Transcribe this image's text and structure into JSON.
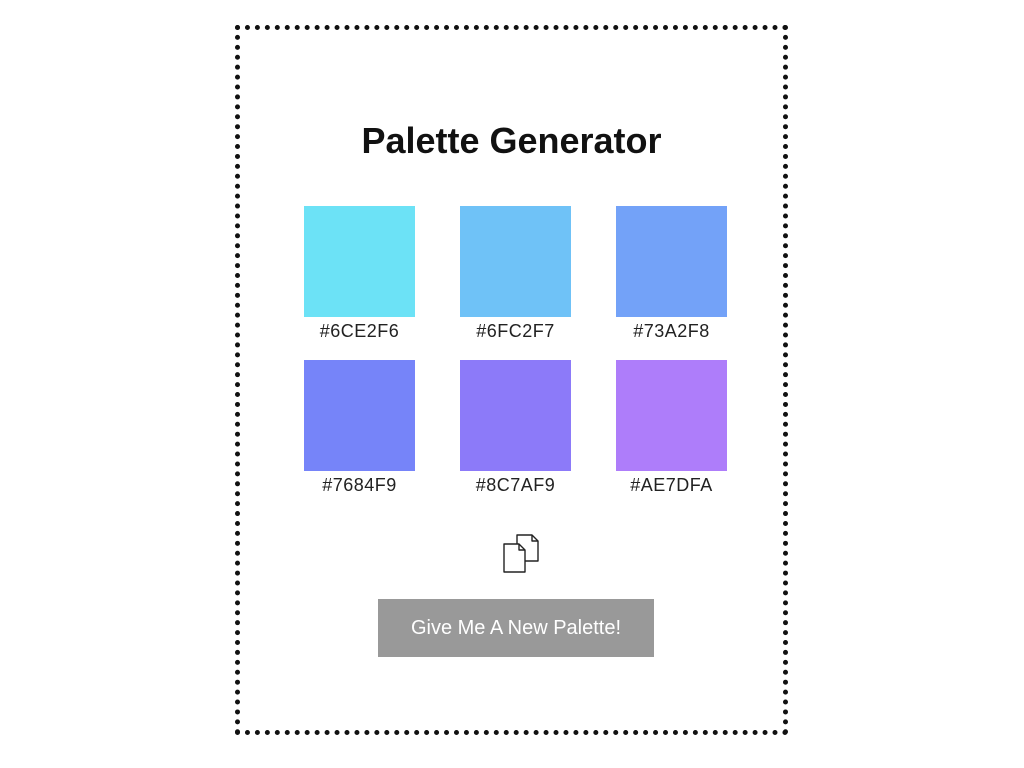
{
  "title": "Palette Generator",
  "palette": [
    {
      "hex": "#6CE2F6",
      "color": "#6CE2F6"
    },
    {
      "hex": "#6FC2F7",
      "color": "#6FC2F7"
    },
    {
      "hex": "#73A2F8",
      "color": "#73A2F8"
    },
    {
      "hex": "#7684F9",
      "color": "#7684F9"
    },
    {
      "hex": "#8C7AF9",
      "color": "#8C7AF9"
    },
    {
      "hex": "#AE7DFA",
      "color": "#AE7DFA"
    }
  ],
  "copy_icon": "copy-documents-icon",
  "button_label": "Give Me A New Palette!"
}
